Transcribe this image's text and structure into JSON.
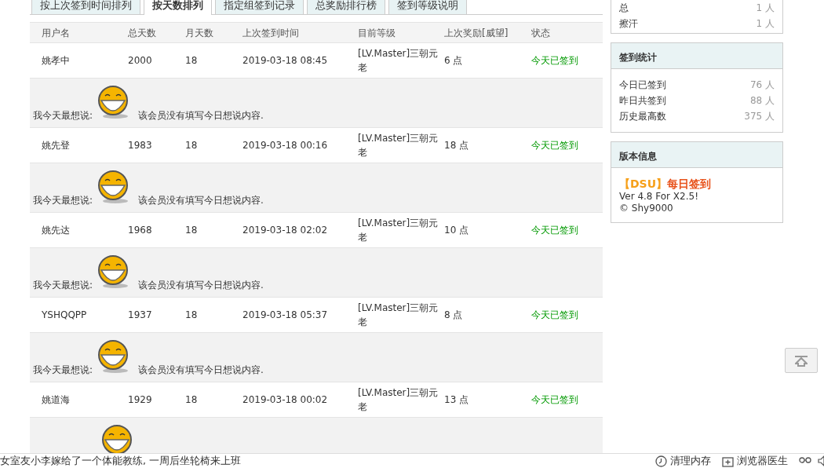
{
  "tabs": [
    {
      "label": "按上次签到时间排列",
      "selected": false
    },
    {
      "label": "按天数排列",
      "selected": true
    },
    {
      "label": "指定组签到记录",
      "selected": false
    },
    {
      "label": "总奖励排行榜",
      "selected": false
    },
    {
      "label": "签到等级说明",
      "selected": false
    }
  ],
  "table": {
    "columns": [
      "用户名",
      "总天数",
      "月天数",
      "上次签到时间",
      "目前等级",
      "上次奖励[威望]",
      "状态"
    ],
    "rows": [
      {
        "user": "姚孝中",
        "total_days": "2000",
        "month_days": "18",
        "last_time": "2019-03-18 08:45",
        "level": "[LV.Master]三朝元老",
        "reward": "6 点",
        "status": "今天已签到",
        "said_label": "我今天最想说:",
        "said_text": "该会员没有填写今日想说内容."
      },
      {
        "user": "姚先登",
        "total_days": "1983",
        "month_days": "18",
        "last_time": "2019-03-18 00:16",
        "level": "[LV.Master]三朝元老",
        "reward": "18 点",
        "status": "今天已签到",
        "said_label": "我今天最想说:",
        "said_text": "该会员没有填写今日想说内容."
      },
      {
        "user": "姚先达",
        "total_days": "1968",
        "month_days": "18",
        "last_time": "2019-03-18 02:02",
        "level": "[LV.Master]三朝元老",
        "reward": "10 点",
        "status": "今天已签到",
        "said_label": "我今天最想说:",
        "said_text": "该会员没有填写今日想说内容."
      },
      {
        "user": "YSHQQPP",
        "total_days": "1937",
        "month_days": "18",
        "last_time": "2019-03-18 05:37",
        "level": "[LV.Master]三朝元老",
        "reward": "8 点",
        "status": "今天已签到",
        "said_label": "我今天最想说:",
        "said_text": "该会员没有填写今日想说内容."
      },
      {
        "user": "姚道海",
        "total_days": "1929",
        "month_days": "18",
        "last_time": "2019-03-18 00:02",
        "level": "[LV.Master]三朝元老",
        "reward": "13 点",
        "status": "今天已签到"
      }
    ]
  },
  "sidebar": {
    "mood_card": {
      "rows": [
        {
          "label": "总",
          "value": "1 人"
        },
        {
          "label": "擦汗",
          "value": "1 人"
        }
      ]
    },
    "stats_card": {
      "title": "签到统计",
      "rows": [
        {
          "label": "今日已签到",
          "value": "76 人"
        },
        {
          "label": "昨日共签到",
          "value": "88 人"
        },
        {
          "label": "历史最高数",
          "value": "375 人"
        }
      ]
    },
    "version_card": {
      "title": "版本信息",
      "brand": "【DSU】",
      "name": "每日签到",
      "version": "Ver 4.8 For X2.5!",
      "copyright": "© Shy9000"
    }
  },
  "status_bar": {
    "news": "女室友小李嫁给了一个体能教练, 一周后坐轮椅来上班",
    "items": [
      "清理内存",
      "浏览器医生"
    ]
  }
}
